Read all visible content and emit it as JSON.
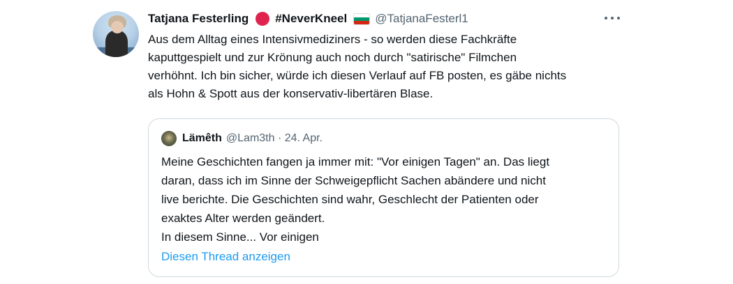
{
  "tweet": {
    "display_name": "Tatjana Festerling",
    "hashtag": "#NeverKneel",
    "handle": "@TatjanaFesterl1",
    "text_lines": [
      "Aus dem Alltag eines Intensivmediziners - so werden diese Fachkräfte",
      "kaputtgespielt und zur Krönung auch noch durch \"satirische\" Filmchen",
      "verhöhnt. Ich bin sicher, würde ich diesen Verlauf auf FB posten, es gäbe nichts",
      "als Hohn & Spott aus der konservativ-libertären Blase."
    ],
    "emoji": [
      "red-circle-icon",
      "bulgaria-flag-icon"
    ],
    "colors": {
      "red_dot": "#e0234e",
      "flag": [
        "#ffffff",
        "#00966e",
        "#d62612"
      ]
    }
  },
  "quote": {
    "display_name": "Lämêth",
    "handle_date": "@Lam3th · 24. Apr.",
    "text_lines": [
      "Meine Geschichten fangen ja immer mit: \"Vor einigen Tagen\" an. Das liegt",
      "daran, dass ich im Sinne der Schweigepflicht Sachen abändere und nicht",
      "live berichte. Die Geschichten sind wahr, Geschlecht der Patienten oder",
      "exaktes Alter werden geändert.",
      "In diesem Sinne... Vor einigen"
    ],
    "show_thread_label": "Diesen Thread anzeigen"
  },
  "theme": {
    "link_color": "#1d9bf0",
    "secondary_text": "#536471",
    "border": "#cfd9de"
  }
}
